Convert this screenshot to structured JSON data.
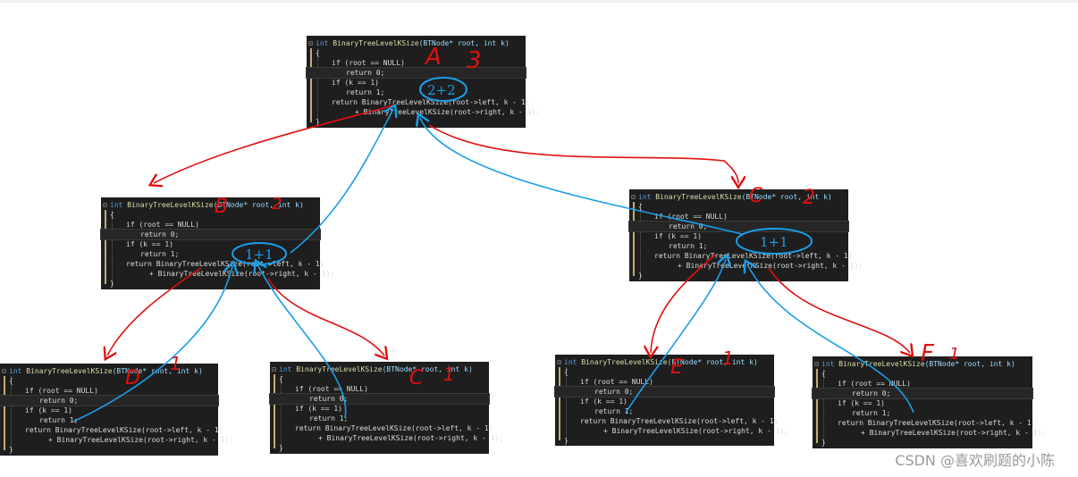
{
  "code": {
    "signature_kw": "int",
    "signature_fn": "BinaryTreeLevelKSize",
    "signature_params": "(BTNode* root, int k)",
    "open_brace": "{",
    "line_if_root": "if (root == NULL)",
    "line_return0": "return 0;",
    "line_if_k": "if (k == 1)",
    "line_return1": "return 1;",
    "line_return_left": "return BinaryTreeLevelKSize(root->left, k - 1)",
    "line_plus_right": "+ BinaryTreeLevelKSize(root->right, k - 1);",
    "close_brace": "}"
  },
  "annotations": {
    "a_label": "A",
    "a_k": "3",
    "a_sum": "2+2",
    "b_label": "B",
    "b_k": "2",
    "b_sum": "1+1",
    "c_label": "C",
    "c_k": "2",
    "c_sum": "1+1",
    "d_label": "D",
    "d_k": "1",
    "c1_label": "C",
    "c1_k": "1",
    "e_label": "E",
    "e_k": "1",
    "f_label": "F",
    "f_k": "1"
  },
  "watermark": "CSDN @喜欢刷题的小陈",
  "colors": {
    "call_arrow": "#e01010",
    "return_arrow": "#1a9ee8",
    "code_bg": "#1e1e1e"
  }
}
